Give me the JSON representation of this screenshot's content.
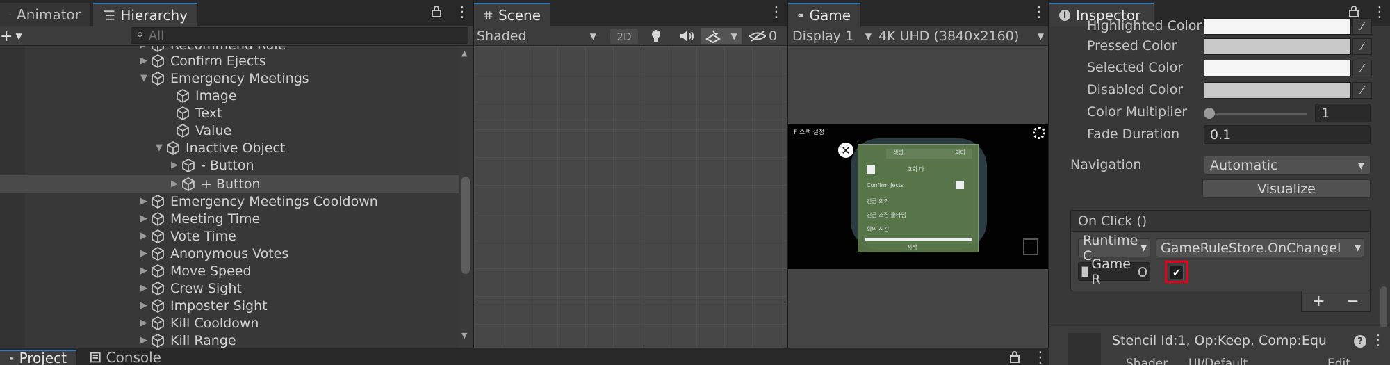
{
  "left": {
    "tabs": {
      "animator": "Animator",
      "hierarchy": "Hierarchy"
    },
    "search": {
      "placeholder": "All"
    },
    "rows": [
      {
        "label": "Recommend Rule"
      },
      {
        "label": "Confirm Ejects"
      },
      {
        "label": "Emergency Meetings"
      },
      {
        "label": "Image"
      },
      {
        "label": "Text"
      },
      {
        "label": "Value"
      },
      {
        "label": "Inactive Object"
      },
      {
        "label": "- Button"
      },
      {
        "label": "+ Button"
      },
      {
        "label": "Emergency Meetings Cooldown"
      },
      {
        "label": "Meeting Time"
      },
      {
        "label": "Vote Time"
      },
      {
        "label": "Anonymous Votes"
      },
      {
        "label": "Move Speed"
      },
      {
        "label": "Crew Sight"
      },
      {
        "label": "Imposter Sight"
      },
      {
        "label": "Kill Cooldown"
      },
      {
        "label": "Kill Range"
      }
    ]
  },
  "bottom": {
    "tabs": {
      "project": "Project",
      "console": "Console"
    }
  },
  "scene": {
    "tab": "Scene",
    "shading": "Shaded",
    "mode_2d": "2D",
    "hidden_count": "0"
  },
  "game": {
    "tab": "Game",
    "display": "Display 1",
    "resolution": "4K UHD (3840x2160)",
    "preview": {
      "title": "F 스택 설정",
      "col1": "섹션",
      "col2": "외미",
      "mid_label": "호회 다",
      "row_confirm": "Confirm Jects",
      "row1": "긴급 회의",
      "row2": "긴급 소집 쿨타임",
      "row3": "회의 시간",
      "footer": "시작"
    }
  },
  "inspector": {
    "tab": "Inspector",
    "highlighted_label": "Highlighted Color",
    "pressed_label": "Pressed Color",
    "selected_label": "Selected Color",
    "disabled_label": "Disabled Color",
    "multiplier_label": "Color Multiplier",
    "multiplier_value": "1",
    "multiplier_fraction": 0,
    "fade_label": "Fade Duration",
    "fade_value": "0.1",
    "navigation_label": "Navigation",
    "navigation_value": "Automatic",
    "visualize": "Visualize",
    "onclick_header": "On Click ()",
    "runtime_value": "Runtime C",
    "function_value": "GameRuleStore.OnChangeI",
    "object_value": "Game R",
    "add": "+",
    "remove": "−",
    "stencil": "Stencil Id:1, Op:Keep, Comp:Equ",
    "shader_label": "Shader",
    "shader_value": "UI/Default",
    "edit": "Edit..."
  }
}
